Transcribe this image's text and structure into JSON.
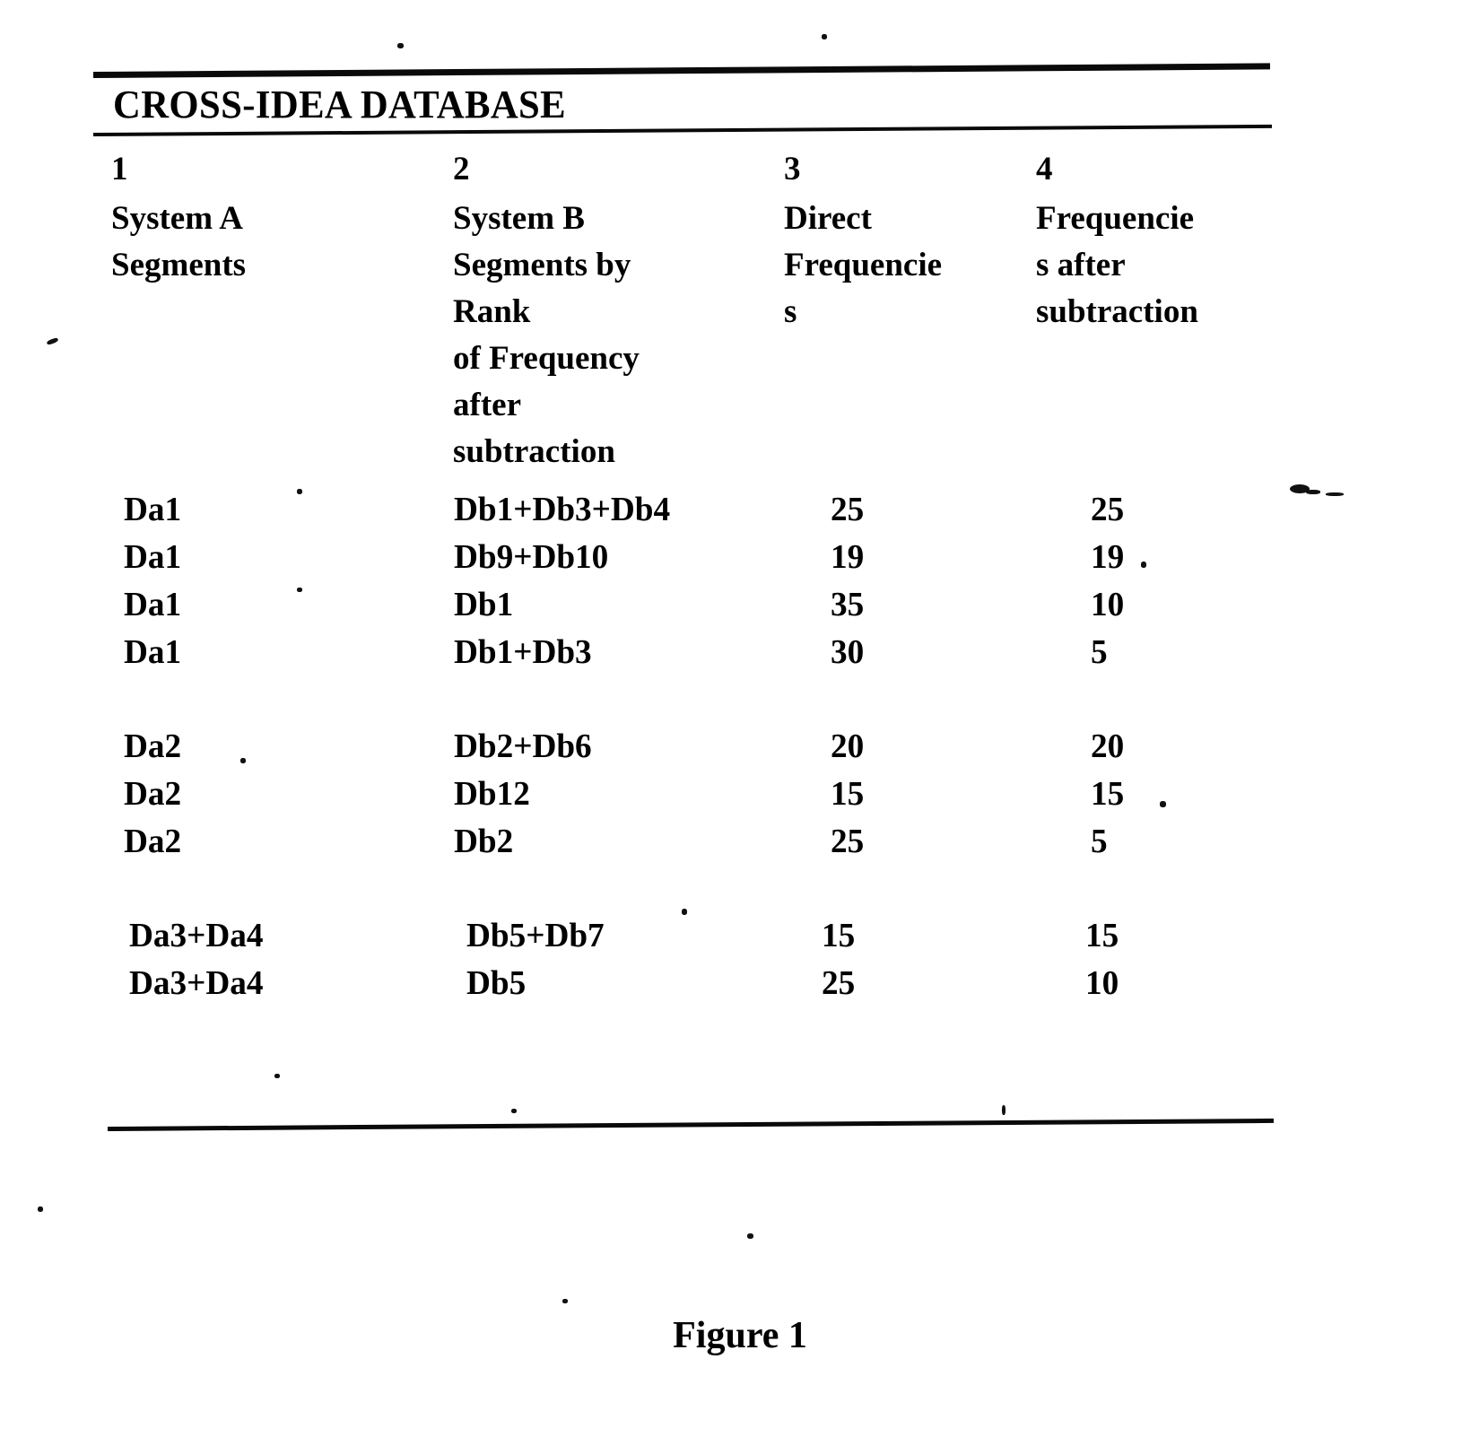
{
  "document": {
    "title": "CROSS-IDEA DATABASE",
    "figure_caption": "Figure 1"
  },
  "table": {
    "columns": [
      {
        "number": "1",
        "lines": [
          "System A",
          "Segments"
        ]
      },
      {
        "number": "2",
        "lines": [
          "System B",
          "Segments by",
          "Rank",
          "of Frequency",
          "after",
          "subtraction"
        ]
      },
      {
        "number": "3",
        "lines": [
          "Direct",
          "Frequencie",
          "s"
        ]
      },
      {
        "number": "4",
        "lines": [
          "Frequencie",
          "s after",
          "subtraction"
        ]
      }
    ],
    "groups": [
      {
        "rows": [
          {
            "system_a": "Da1",
            "system_b": "Db1+Db3+Db4",
            "direct_frequency": "25",
            "frequency_after_subtraction": "25"
          },
          {
            "system_a": "Da1",
            "system_b": "Db9+Db10",
            "direct_frequency": "19",
            "frequency_after_subtraction": "19"
          },
          {
            "system_a": "Da1",
            "system_b": "Db1",
            "direct_frequency": "35",
            "frequency_after_subtraction": "10"
          },
          {
            "system_a": "Da1",
            "system_b": "Db1+Db3",
            "direct_frequency": "30",
            "frequency_after_subtraction": "5"
          }
        ]
      },
      {
        "rows": [
          {
            "system_a": "Da2",
            "system_b": "Db2+Db6",
            "direct_frequency": "20",
            "frequency_after_subtraction": "20"
          },
          {
            "system_a": "Da2",
            "system_b": "Db12",
            "direct_frequency": "15",
            "frequency_after_subtraction": "15"
          },
          {
            "system_a": "Da2",
            "system_b": "Db2",
            "direct_frequency": "25",
            "frequency_after_subtraction": "5"
          }
        ]
      },
      {
        "rows": [
          {
            "system_a": "Da3+Da4",
            "system_b": "Db5+Db7",
            "direct_frequency": "15",
            "frequency_after_subtraction": "15"
          },
          {
            "system_a": "Da3+Da4",
            "system_b": "Db5",
            "direct_frequency": "25",
            "frequency_after_subtraction": "10"
          }
        ]
      }
    ]
  }
}
